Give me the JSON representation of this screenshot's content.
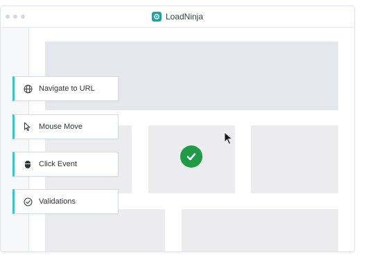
{
  "app": {
    "title": "LoadNinja",
    "brand_color": "#20a3a0"
  },
  "steps": [
    {
      "label": "Navigate to URL",
      "icon": "globe-icon"
    },
    {
      "label": "Mouse Move",
      "icon": "mouse-pointer-icon"
    },
    {
      "label": "Click Event",
      "icon": "mouse-icon"
    },
    {
      "label": "Validations",
      "icon": "check-circle-icon"
    }
  ],
  "colors": {
    "accent": "#3cc2d6",
    "success": "#1e9b45",
    "placeholder": "#e4e7eb"
  }
}
